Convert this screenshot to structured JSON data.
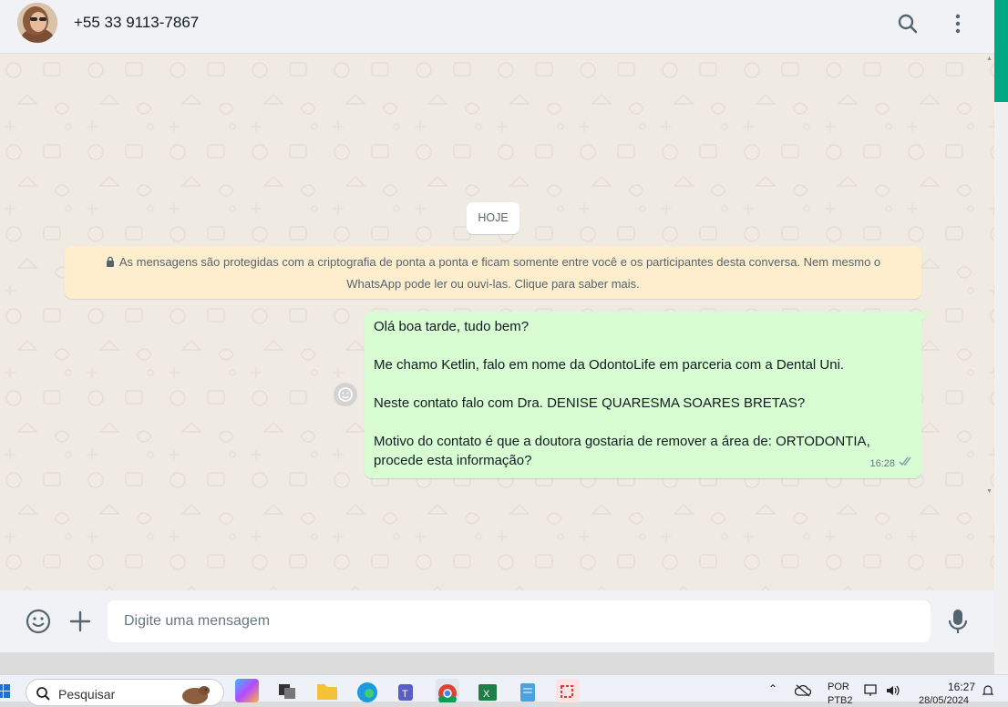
{
  "header": {
    "contact_name": "+55 33 9113-7867",
    "icons": [
      "search-icon",
      "menu-dots-icon"
    ]
  },
  "chat": {
    "date_label": "HOJE",
    "encryption_notice": "As mensagens são protegidas com a criptografia de ponta a ponta e ficam somente entre você e os participantes desta conversa. Nem mesmo o WhatsApp pode ler ou ouvi-las. Clique para saber mais.",
    "message": {
      "lines": [
        "Olá boa tarde, tudo bem?",
        "Me chamo Ketlin, falo em nome da OdontoLife em parceria com a Dental Uni.",
        "Neste contato falo com Dra. DENISE QUARESMA SOARES BRETAS?",
        "Motivo do contato é que a doutora gostaria de remover a área de: ORTODONTIA, procede esta informação?"
      ],
      "time": "16:28",
      "status": "read"
    }
  },
  "footer": {
    "input_placeholder": "Digite uma mensagem",
    "icons": [
      "emoji-icon",
      "plus-icon",
      "microphone-icon"
    ]
  },
  "taskbar": {
    "search_label": "Pesquisar",
    "language_top": "POR",
    "language_bottom": "PTB2",
    "time": "16:27",
    "date": "28/05/2024"
  },
  "colors": {
    "accent": "#00a884",
    "outgoing_bubble": "#d9fdd3",
    "notice_bg": "#ffeecd",
    "chat_bg": "#efeae2"
  }
}
